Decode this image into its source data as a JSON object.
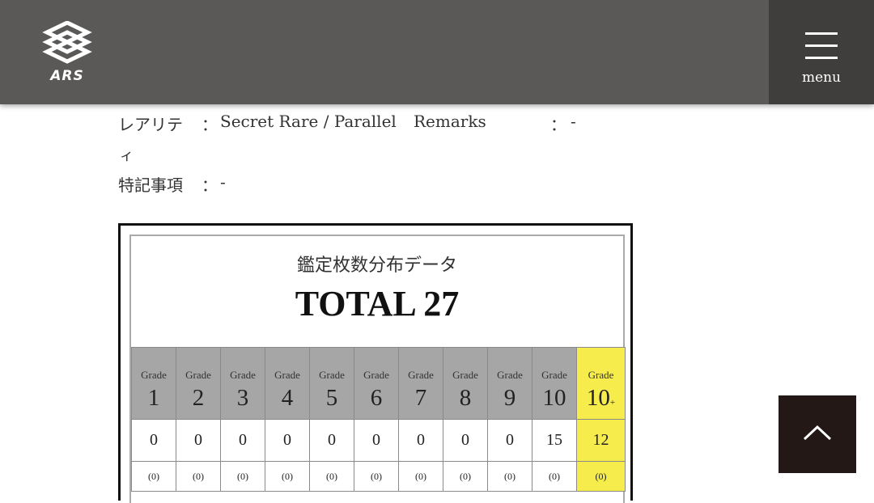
{
  "header": {
    "logo_text": "ARS",
    "menu_label": "menu"
  },
  "info": {
    "rarity_label": "レアリテ",
    "rarity_label_wrap": "ィ",
    "colon": "：",
    "rarity_value": "Secret Rare / Parallel",
    "remarks_label": "Remarks",
    "remarks_value": "-",
    "special_label": "特記事項",
    "special_value": "-"
  },
  "distribution": {
    "title": "鑑定枚数分布データ",
    "total": "TOTAL 27",
    "grade_word": "Grade",
    "grades": [
      {
        "num": "1",
        "count": "0",
        "pct": "(0)"
      },
      {
        "num": "2",
        "count": "0",
        "pct": "(0)"
      },
      {
        "num": "3",
        "count": "0",
        "pct": "(0)"
      },
      {
        "num": "4",
        "count": "0",
        "pct": "(0)"
      },
      {
        "num": "5",
        "count": "0",
        "pct": "(0)"
      },
      {
        "num": "6",
        "count": "0",
        "pct": "(0)"
      },
      {
        "num": "7",
        "count": "0",
        "pct": "(0)"
      },
      {
        "num": "8",
        "count": "0",
        "pct": "(0)"
      },
      {
        "num": "9",
        "count": "0",
        "pct": "(0)"
      },
      {
        "num": "10",
        "count": "15",
        "pct": "(0)"
      },
      {
        "num": "10",
        "plus": "+",
        "count": "12",
        "pct": "(0)"
      }
    ]
  },
  "colors": {
    "header_bg": "#5a5958",
    "menu_bg": "#3f3e3d",
    "grade_header_bg": "#a6a6a6",
    "highlight_yellow": "#f6ec4c",
    "to_top_bg": "#231815"
  },
  "icons": {
    "logo": "ars-logo-icon",
    "menu": "hamburger-icon",
    "to_top": "chevron-up-icon"
  }
}
